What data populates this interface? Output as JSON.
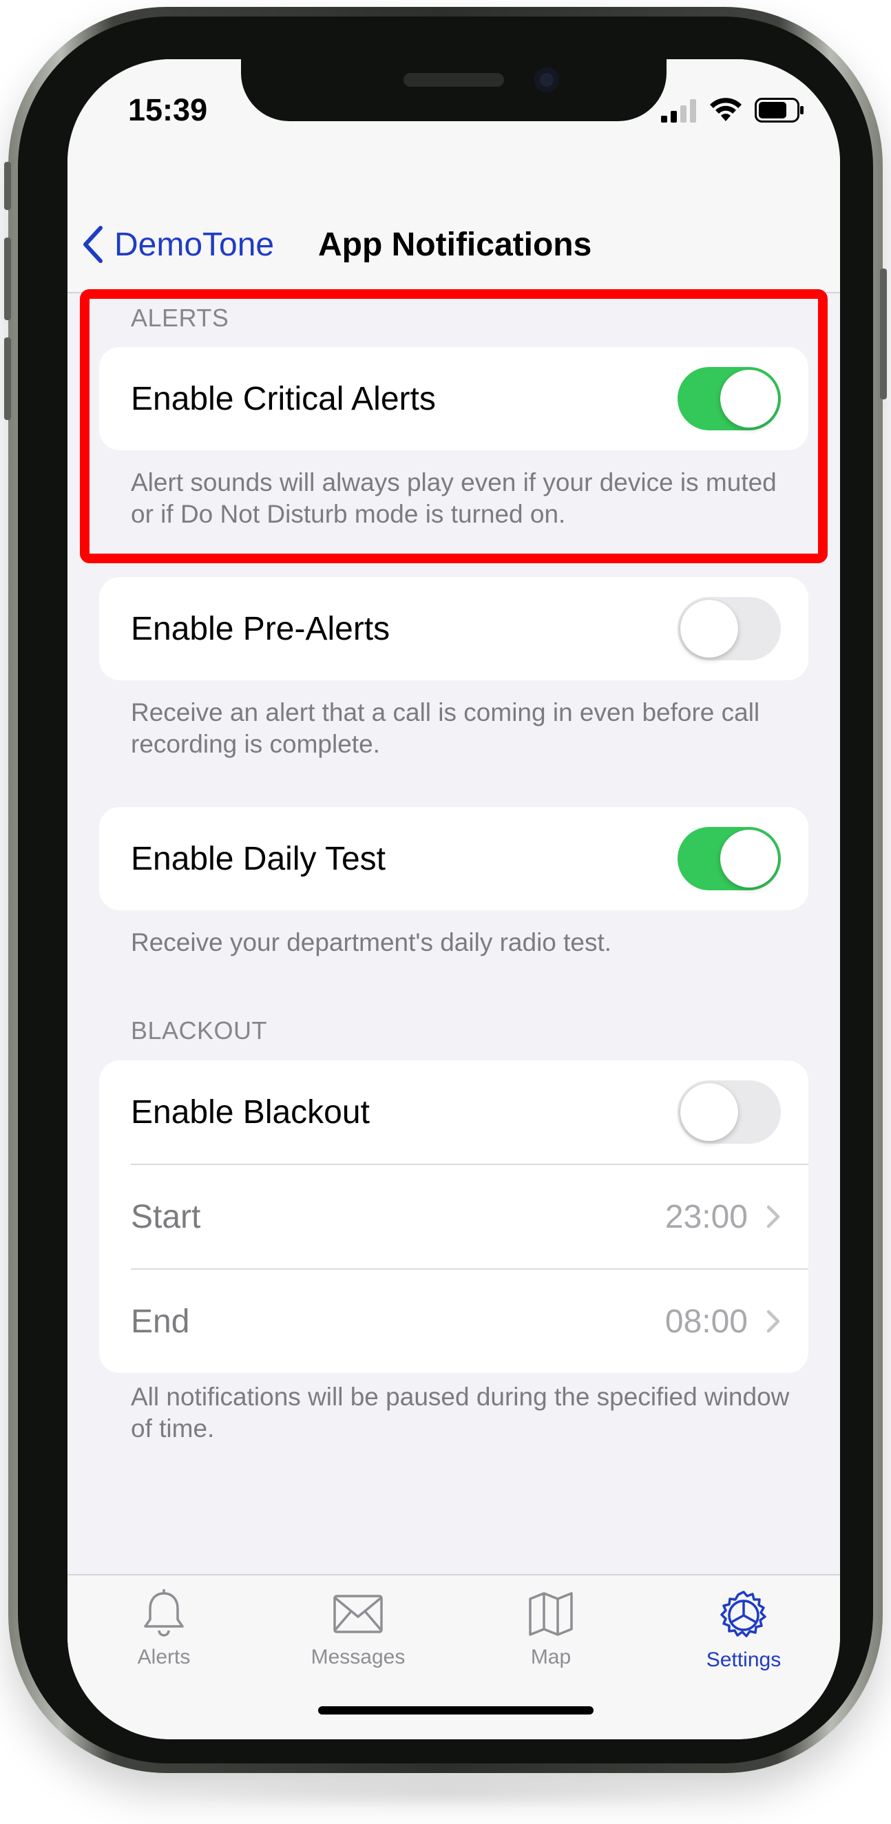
{
  "status_bar": {
    "time": "15:39",
    "icons": [
      "cellular-signal-icon",
      "wifi-icon",
      "battery-icon"
    ]
  },
  "nav": {
    "back_label": "DemoTone",
    "title": "App Notifications"
  },
  "sections": {
    "alerts_header": "ALERTS",
    "blackout_header": "BLACKOUT"
  },
  "settings": {
    "critical_alerts": {
      "label": "Enable Critical Alerts",
      "enabled": true,
      "footer": "Alert sounds will always play even if your device is muted or if Do Not Disturb mode is turned on."
    },
    "pre_alerts": {
      "label": "Enable Pre-Alerts",
      "enabled": false,
      "footer": "Receive an alert that a call is coming in even before call recording is complete."
    },
    "daily_test": {
      "label": "Enable Daily Test",
      "enabled": true,
      "footer": "Receive your department's daily radio test."
    },
    "blackout": {
      "label": "Enable Blackout",
      "enabled": false,
      "start_label": "Start",
      "start_value": "23:00",
      "end_label": "End",
      "end_value": "08:00",
      "footer": "All notifications will be paused during the specified window of time."
    }
  },
  "tabs": [
    {
      "label": "Alerts",
      "icon": "bell-icon",
      "active": false
    },
    {
      "label": "Messages",
      "icon": "envelope-icon",
      "active": false
    },
    {
      "label": "Map",
      "icon": "map-icon",
      "active": false
    },
    {
      "label": "Settings",
      "icon": "settings-gear-icon",
      "active": true
    }
  ],
  "colors": {
    "accent": "#1f3cc4",
    "toggle_on": "#34c759",
    "toggle_off": "#e9e9eb",
    "highlight": "#ff0000",
    "background": "#f2f2f7"
  }
}
